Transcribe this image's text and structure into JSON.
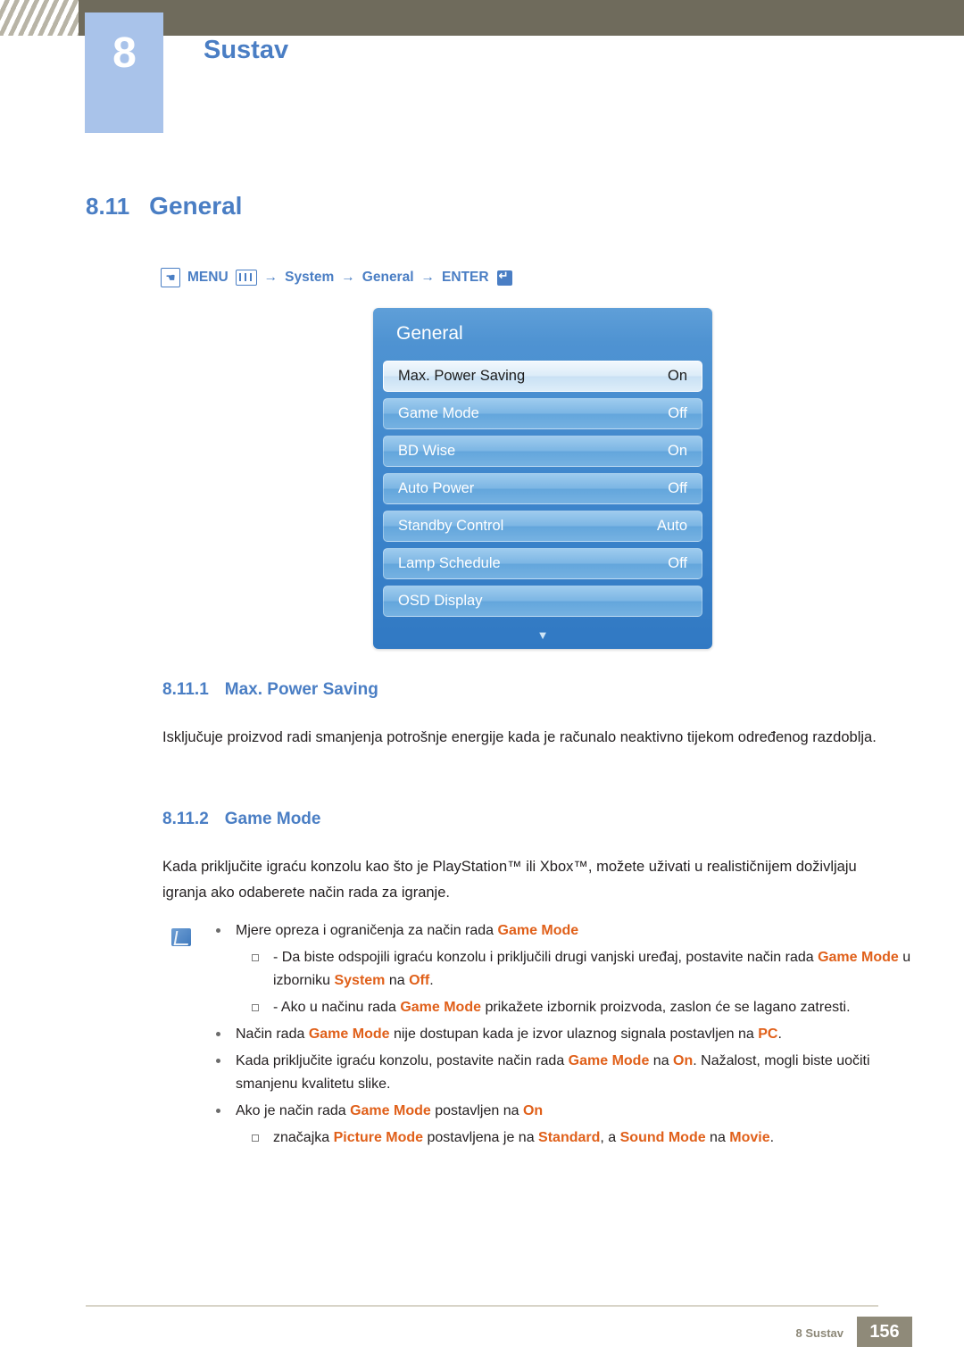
{
  "header": {
    "chapter_number": "8",
    "chapter_title": "Sustav"
  },
  "section": {
    "number": "8.11",
    "title": "General"
  },
  "menu_path": {
    "hand_icon": "hand-pointer-icon",
    "menu_label": "MENU",
    "menu_icon": "menu-bars-icon",
    "arrow1": "→",
    "item1": "System",
    "arrow2": "→",
    "item2": "General",
    "arrow3": "→",
    "enter_label": "ENTER",
    "enter_icon": "enter-key-icon"
  },
  "osd": {
    "title": "General",
    "rows": [
      {
        "label": "Max. Power Saving",
        "value": "On",
        "selected": true
      },
      {
        "label": "Game Mode",
        "value": "Off",
        "selected": false
      },
      {
        "label": "BD Wise",
        "value": "On",
        "selected": false
      },
      {
        "label": "Auto Power",
        "value": "Off",
        "selected": false
      },
      {
        "label": "Standby Control",
        "value": "Auto",
        "selected": false
      },
      {
        "label": "Lamp Schedule",
        "value": "Off",
        "selected": false
      },
      {
        "label": "OSD Display",
        "value": "",
        "selected": false
      }
    ],
    "scroll_down_icon": "▼"
  },
  "sub1": {
    "number": "8.11.1",
    "title": "Max. Power Saving",
    "body": "Isključuje proizvod radi smanjenja potrošnje energije kada je računalo neaktivno tijekom određenog razdoblja."
  },
  "sub2": {
    "number": "8.11.2",
    "title": "Game Mode",
    "body": "Kada priključite igraću konzolu kao što je PlayStation™ ili Xbox™, možete uživati u realističnijem doživljaju igranja ako odaberete način rada za igranje."
  },
  "notes": {
    "icon": "note-icon",
    "b1_pre": "Mjere opreza i ograničenja za način rada ",
    "b1_kw": "Game Mode",
    "s1_a": "- Da biste odspojili igraću konzolu i priključili drugi vanjski uređaj, postavite način rada ",
    "s1_kw1": "Game Mode",
    "s1_b": " u izborniku ",
    "s1_kw2": "System",
    "s1_c": " na ",
    "s1_kw3": "Off",
    "s1_d": ".",
    "s2_a": "- Ako u načinu rada ",
    "s2_kw1": "Game Mode",
    "s2_b": " prikažete izbornik proizvoda, zaslon će se lagano zatresti.",
    "b2_a": "Način rada ",
    "b2_kw1": "Game Mode",
    "b2_b": " nije dostupan kada je izvor ulaznog signala postavljen na ",
    "b2_kw2": "PC",
    "b2_c": ".",
    "b3_a": "Kada priključite igraću konzolu, postavite način rada ",
    "b3_kw1": "Game Mode",
    "b3_b": " na ",
    "b3_kw2": "On",
    "b3_c": ". Nažalost, mogli biste uočiti smanjenu kvalitetu slike.",
    "b4_a": "Ako je način rada ",
    "b4_kw1": "Game Mode",
    "b4_b": " postavljen na ",
    "b4_kw2": "On",
    "s3_a": "značajka ",
    "s3_kw1": "Picture Mode",
    "s3_b": " postavljena je na ",
    "s3_kw2": "Standard",
    "s3_c": ", a ",
    "s3_kw3": "Sound Mode",
    "s3_d": " na ",
    "s3_kw4": "Movie",
    "s3_e": "."
  },
  "footer": {
    "label": "8 Sustav",
    "page": "156"
  },
  "colors": {
    "accent_blue": "#4a7ec4",
    "keyword_orange": "#e0601a",
    "header_brown": "#6f6b5c"
  }
}
